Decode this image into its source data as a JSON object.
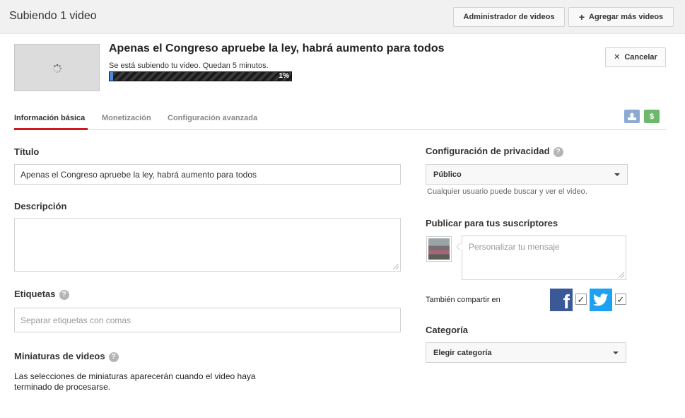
{
  "header": {
    "title": "Subiendo 1 video",
    "manager_button": "Administrador de videos",
    "add_more_button": "Agregar más videos"
  },
  "upload": {
    "video_title": "Apenas el Congreso apruebe la ley, habrá aumento para todos",
    "status_text": "Se está subiendo tu video. Quedan 5 minutos.",
    "progress_percent": 1,
    "progress_label": "1%",
    "cancel_button": "Cancelar"
  },
  "tabs": [
    {
      "label": "Información básica",
      "active": true
    },
    {
      "label": "Monetización",
      "active": false
    },
    {
      "label": "Configuración avanzada",
      "active": false
    }
  ],
  "tab_icons": [
    {
      "name": "upload-icon",
      "color": "#8aaad4"
    },
    {
      "name": "dollar-icon",
      "color": "#6cb96c",
      "glyph": "$"
    }
  ],
  "form": {
    "title_label": "Título",
    "title_value": "Apenas el Congreso apruebe la ley, habrá aumento para todos",
    "description_label": "Descripción",
    "description_value": "",
    "tags_label": "Etiquetas",
    "tags_placeholder": "Separar etiquetas con comas",
    "thumbnails_label": "Miniaturas de videos",
    "thumbnails_text": "Las selecciones de miniaturas aparecerán cuando el video haya terminado de procesarse.",
    "help_glyph": "?"
  },
  "privacy": {
    "label": "Configuración de privacidad",
    "selected": "Público",
    "note": "Cualquier usuario puede buscar y ver el video."
  },
  "publish": {
    "label": "Publicar para tus suscriptores",
    "message_placeholder": "Personalizar tu mensaje",
    "share_label": "También compartir en",
    "facebook_checked": true,
    "twitter_checked": true,
    "check_glyph": "✓",
    "facebook_glyph": "f"
  },
  "category": {
    "label": "Categoría",
    "selected": "Elegir categoría"
  },
  "colors": {
    "accent_red": "#cc181e",
    "progress_blue": "#4a8bd8",
    "facebook": "#3b5998",
    "twitter": "#1da1f2"
  }
}
